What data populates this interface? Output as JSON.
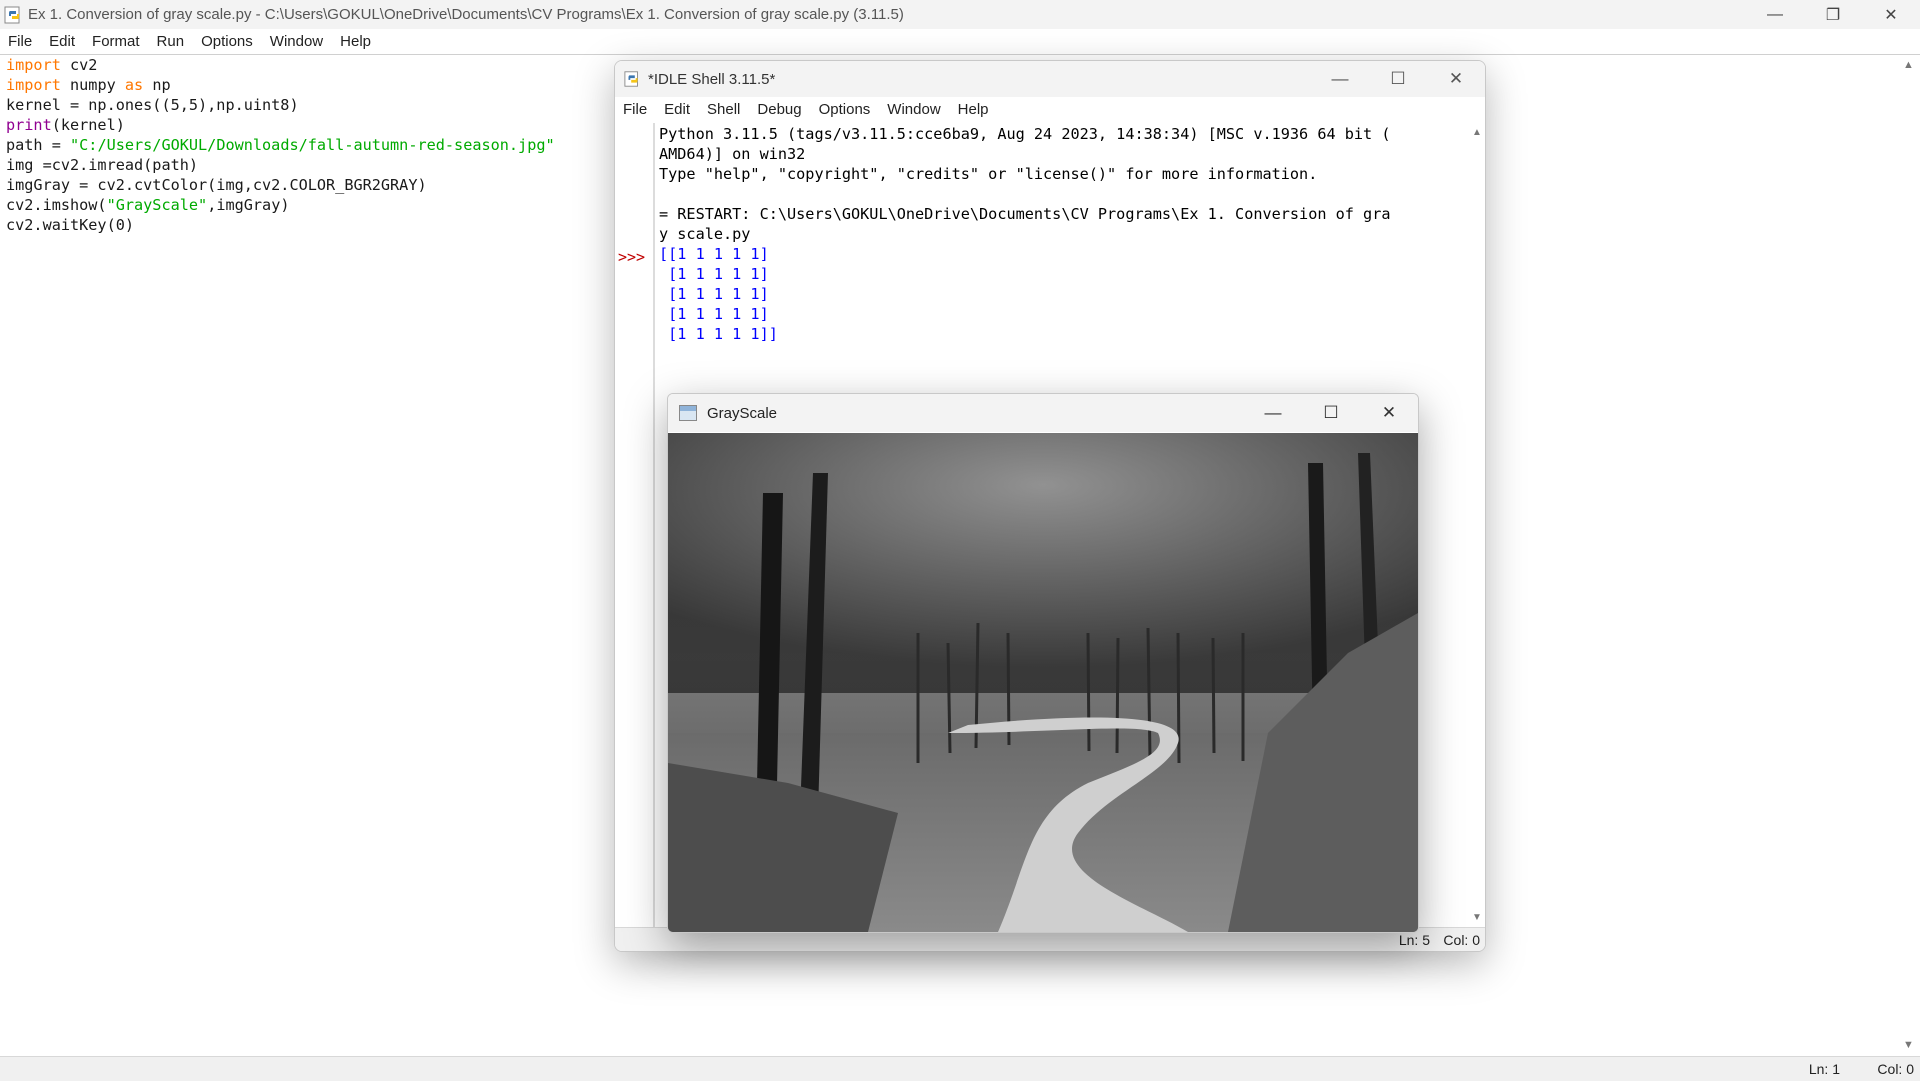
{
  "editor_window": {
    "title": "Ex 1. Conversion of gray scale.py - C:\\Users\\GOKUL\\OneDrive\\Documents\\CV Programs\\Ex 1. Conversion of gray scale.py (3.11.5)",
    "menu": [
      "File",
      "Edit",
      "Format",
      "Run",
      "Options",
      "Window",
      "Help"
    ],
    "code": [
      [
        {
          "t": "import",
          "c": "kw"
        },
        {
          "t": " cv2",
          "c": ""
        }
      ],
      [
        {
          "t": "import",
          "c": "kw"
        },
        {
          "t": " numpy ",
          "c": ""
        },
        {
          "t": "as",
          "c": "kw"
        },
        {
          "t": " np",
          "c": ""
        }
      ],
      [
        {
          "t": "kernel = np.ones((5,5),np.uint8)",
          "c": ""
        }
      ],
      [
        {
          "t": "print",
          "c": "bi"
        },
        {
          "t": "(kernel)",
          "c": ""
        }
      ],
      [
        {
          "t": "path = ",
          "c": ""
        },
        {
          "t": "\"C:/Users/GOKUL/Downloads/fall-autumn-red-season.jpg\"",
          "c": "str"
        }
      ],
      [
        {
          "t": "img =cv2.imread(path)",
          "c": ""
        }
      ],
      [
        {
          "t": "imgGray = cv2.cvtColor(img,cv2.COLOR_BGR2GRAY)",
          "c": ""
        }
      ],
      [
        {
          "t": "cv2.imshow(",
          "c": ""
        },
        {
          "t": "\"GrayScale\"",
          "c": "str"
        },
        {
          "t": ",imgGray)",
          "c": ""
        }
      ],
      [
        {
          "t": "cv2.waitKey(0)",
          "c": ""
        }
      ]
    ],
    "status": {
      "ln": "Ln: 1",
      "col": "Col: 0"
    }
  },
  "shell_window": {
    "title": "*IDLE Shell 3.11.5*",
    "menu": [
      "File",
      "Edit",
      "Shell",
      "Debug",
      "Options",
      "Window",
      "Help"
    ],
    "prompt": ">>>",
    "output": [
      {
        "t": "Python 3.11.5 (tags/v3.11.5:cce6ba9, Aug 24 2023, 14:38:34) [MSC v.1936 64 bit (",
        "c": ""
      },
      {
        "t": "AMD64)] on win32",
        "c": ""
      },
      {
        "t": "Type \"help\", \"copyright\", \"credits\" or \"license()\" for more information.",
        "c": ""
      },
      {
        "t": "",
        "c": ""
      },
      {
        "t": "= RESTART: C:\\Users\\GOKUL\\OneDrive\\Documents\\CV Programs\\Ex 1. Conversion of gra",
        "c": ""
      },
      {
        "t": "y scale.py",
        "c": ""
      },
      {
        "t": "[[1 1 1 1 1]",
        "c": "blue"
      },
      {
        "t": " [1 1 1 1 1]",
        "c": "blue"
      },
      {
        "t": " [1 1 1 1 1]",
        "c": "blue"
      },
      {
        "t": " [1 1 1 1 1]",
        "c": "blue"
      },
      {
        "t": " [1 1 1 1 1]]",
        "c": "blue"
      }
    ],
    "status": {
      "ln": "Ln: 5",
      "col": "Col: 0"
    }
  },
  "grayscale_window": {
    "title": "GrayScale"
  },
  "icons": {
    "minimize": "—",
    "maximize": "☐",
    "restore": "❐",
    "close": "✕",
    "scroll_up": "▲",
    "scroll_down": "▼"
  }
}
